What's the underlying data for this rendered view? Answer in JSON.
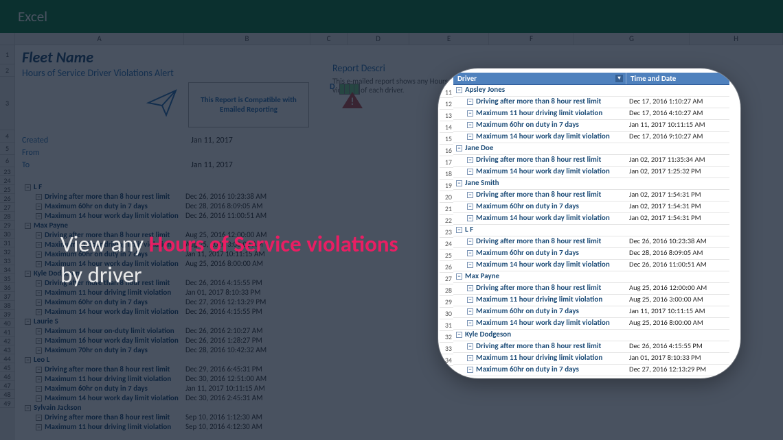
{
  "app": {
    "title": "Excel"
  },
  "columns": [
    "A",
    "B",
    "C",
    "D",
    "E",
    "F",
    "G",
    "H"
  ],
  "report": {
    "fleet_name": "Fleet Name",
    "title": "Hours of Service Driver Violations Alert",
    "compat": "This Report is Compatible with Emailed Reporting",
    "desc_header": "Report Descri",
    "desc_body": "This e-mailed report shows any Hours of Service violation of each driver.",
    "d_label": "D",
    "meta": {
      "created_label": "Created",
      "created_val": "Jan 11, 2017",
      "from_label": "From",
      "from_val": "",
      "to_label": "To",
      "to_val": "Jan 11, 2017"
    }
  },
  "caption": {
    "pre": "View any ",
    "accent": "Hours of Service violations",
    "post": " by driver"
  },
  "bg_rows_start": 23,
  "bg_data": [
    {
      "t": "drv",
      "n": "L F"
    },
    {
      "t": "vio",
      "n": "Driving after more than 8 hour rest limit",
      "d": "Dec 26, 2016 10:23:38 AM"
    },
    {
      "t": "vio",
      "n": "Maximum 60hr on duty in 7 days",
      "d": "Dec 28, 2016 8:09:05 AM"
    },
    {
      "t": "vio",
      "n": "Maximum 14 hour work day limit violation",
      "d": "Dec 26, 2016 11:00:51 AM"
    },
    {
      "t": "drv",
      "n": "Max Payne"
    },
    {
      "t": "vio",
      "n": "Driving after more than 8 hour rest limit",
      "d": "Aug 25, 2016 12:00:00 AM"
    },
    {
      "t": "vio",
      "n": "Maximum 11 hour driving limit violation",
      "d": "Aug 25, 2016 3:00:00 AM"
    },
    {
      "t": "vio",
      "n": "Maximum 60hr on duty in 7 days",
      "d": "Jan 11, 2017 10:11:15 AM"
    },
    {
      "t": "vio",
      "n": "Maximum 14 hour work day limit violation",
      "d": "Aug 25, 2016 8:00:00 AM"
    },
    {
      "t": "drv",
      "n": "Kyle Dodgeson"
    },
    {
      "t": "vio",
      "n": "Driving after more than 8 hour rest limit",
      "d": "Dec 26, 2016 4:15:55 PM"
    },
    {
      "t": "vio",
      "n": "Maximum 11 hour driving limit violation",
      "d": "Jan 01, 2017 8:10:33 PM"
    },
    {
      "t": "vio",
      "n": "Maximum 60hr on duty in 7 days",
      "d": "Dec 27, 2016 12:13:29 PM"
    },
    {
      "t": "vio",
      "n": "Maximum 14 hour work day limit violation",
      "d": "Dec 26, 2016 4:15:55 PM"
    },
    {
      "t": "drv",
      "n": "Laurie S"
    },
    {
      "t": "vio",
      "n": "Maximum 14 hour on-duty limit violation",
      "d": "Dec 26, 2016 2:10:27 AM"
    },
    {
      "t": "vio",
      "n": "Maximum 16 hour work day limit violation",
      "d": "Dec 26, 2016 1:28:27 PM"
    },
    {
      "t": "vio",
      "n": "Maximum 70hr on duty in 7 days",
      "d": "Dec 28, 2016 10:42:32 AM"
    },
    {
      "t": "drv",
      "n": "Leo L"
    },
    {
      "t": "vio",
      "n": "Driving after more than 8 hour rest limit",
      "d": "Dec 29, 2016 6:45:31 PM"
    },
    {
      "t": "vio",
      "n": "Maximum 11 hour driving limit violation",
      "d": "Dec 30, 2016 12:51:00 AM"
    },
    {
      "t": "vio",
      "n": "Maximum 60hr on duty in 7 days",
      "d": "Jan 11, 2017 10:11:15 AM"
    },
    {
      "t": "vio",
      "n": "Maximum 14 hour work day limit violation",
      "d": "Dec 30, 2016 2:45:31 AM"
    },
    {
      "t": "drv",
      "n": "Sylvain Jackson"
    },
    {
      "t": "vio",
      "n": "Driving after more than 8 hour rest limit",
      "d": "Sep 10, 2016 1:12:30 AM"
    },
    {
      "t": "vio",
      "n": "Maximum 11 hour driving limit violation",
      "d": "Sep 10, 2016 4:12:30 AM"
    }
  ],
  "bubble": {
    "row_start": 11,
    "th1": "Driver",
    "th2": "Time and Date",
    "rows": [
      {
        "t": "drv",
        "n": "Apsley Jones"
      },
      {
        "t": "vio",
        "n": "Driving after more than 8 hour rest limit",
        "d": "Dec 17, 2016 1:10:27 AM"
      },
      {
        "t": "vio",
        "n": "Maximum 11 hour driving limit violation",
        "d": "Dec 17, 2016 4:10:27 AM"
      },
      {
        "t": "vio",
        "n": "Maximum 60hr on duty in 7 days",
        "d": "Jan 11, 2017 10:11:15 AM"
      },
      {
        "t": "vio",
        "n": "Maximum 14 hour work day limit violation",
        "d": "Dec 17, 2016 9:10:27 AM"
      },
      {
        "t": "drv",
        "n": "Jane Doe"
      },
      {
        "t": "vio",
        "n": "Driving after more than 8 hour rest limit",
        "d": "Jan 02, 2017 11:35:34 AM"
      },
      {
        "t": "vio",
        "n": "Maximum 14 hour work day limit violation",
        "d": "Jan 02, 2017 1:25:32 PM"
      },
      {
        "t": "drv",
        "n": "Jane Smith"
      },
      {
        "t": "vio",
        "n": "Driving after more than 8 hour rest limit",
        "d": "Jan 02, 2017 1:54:31 PM"
      },
      {
        "t": "vio",
        "n": "Maximum 60hr on duty in 7 days",
        "d": "Jan 02, 2017 1:54:31 PM"
      },
      {
        "t": "vio",
        "n": "Maximum 14 hour work day limit violation",
        "d": "Jan 02, 2017 1:54:31 PM"
      },
      {
        "t": "drv",
        "n": "L F"
      },
      {
        "t": "vio",
        "n": "Driving after more than 8 hour rest limit",
        "d": "Dec 26, 2016 10:23:38 AM"
      },
      {
        "t": "vio",
        "n": "Maximum 60hr on duty in 7 days",
        "d": "Dec 28, 2016 8:09:05 AM"
      },
      {
        "t": "vio",
        "n": "Maximum 14 hour work day limit violation",
        "d": "Dec 26, 2016 11:00:51 AM"
      },
      {
        "t": "drv",
        "n": "Max Payne"
      },
      {
        "t": "vio",
        "n": "Driving after more than 8 hour rest limit",
        "d": "Aug 25, 2016 12:00:00 AM"
      },
      {
        "t": "vio",
        "n": "Maximum 11 hour driving limit violation",
        "d": "Aug 25, 2016 3:00:00 AM"
      },
      {
        "t": "vio",
        "n": "Maximum 60hr on duty in 7 days",
        "d": "Jan 11, 2017 10:11:15 AM"
      },
      {
        "t": "vio",
        "n": "Maximum 14 hour work day limit violation",
        "d": "Aug 25, 2016 8:00:00 AM"
      },
      {
        "t": "drv",
        "n": "Kyle Dodgeson"
      },
      {
        "t": "vio",
        "n": "Driving after more than 8 hour rest limit",
        "d": "Dec 26, 2016 4:15:55 PM"
      },
      {
        "t": "vio",
        "n": "Maximum 11 hour driving limit violation",
        "d": "Jan 01, 2017 8:10:33 PM"
      },
      {
        "t": "vio",
        "n": "Maximum 60hr on duty in 7 days",
        "d": "Dec 27, 2016 12:13:29 PM"
      }
    ]
  }
}
